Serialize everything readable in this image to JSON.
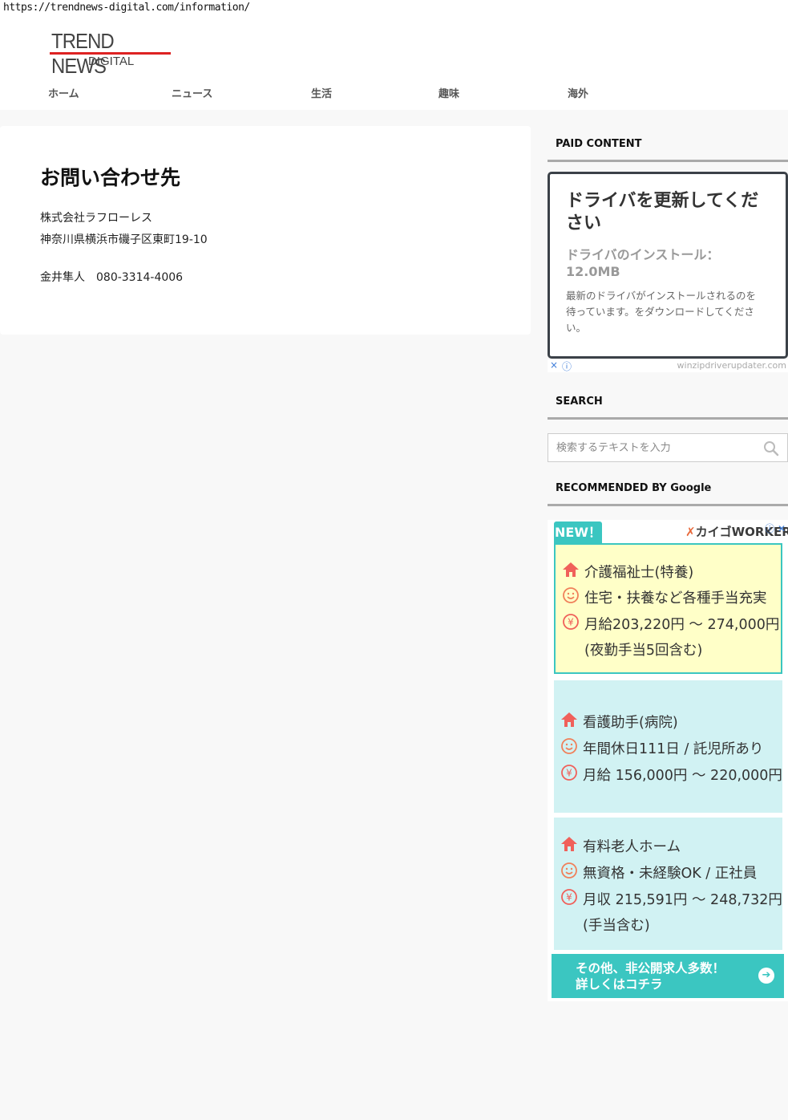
{
  "browser": {
    "url": "https://trendnews-digital.com/information/"
  },
  "site": {
    "logo_main": "TREND NEWS",
    "logo_sub": "DIGITAL",
    "brand_color": "#dd2222"
  },
  "nav": {
    "items": [
      "ホーム",
      "ニュース",
      "生活",
      "趣味",
      "海外"
    ]
  },
  "page": {
    "title": "お問い合わせ先",
    "company": "株式会社ラフローレス",
    "address": "神奈川県横浜市磯子区東町19-10",
    "contact": "金井隼人　080-3314-4006"
  },
  "sidebar": {
    "paid_heading": "PAID CONTENT",
    "search_heading": "SEARCH",
    "recommended_heading": "RECOMMENDED BY Google",
    "search_placeholder": "検索するテキストを入力"
  },
  "ad_driver": {
    "title": "ドライバを更新してください",
    "subtitle": "ドライバのインストール：12.0MB",
    "description": "最新のドライバがインストールされるのを待っています。をダウンロードしてください。",
    "close_icon": "×",
    "info_icon": "ⓘ",
    "domain": "winzipdriverupdater.com"
  },
  "ad_jobs": {
    "badge": "NEW！",
    "brand": "カイゴWORKER",
    "accent_color": "#3bc6c1",
    "cards": [
      {
        "lines": [
          "介護福祉士(特養)",
          "住宅・扶養など各種手当充実",
          "月給203,220円 〜 274,000円",
          "(夜勤手当5回含む)"
        ]
      },
      {
        "lines": [
          "看護助手(病院)",
          "年間休日111日 / 託児所あり",
          "月給 156,000円 〜 220,000円"
        ]
      },
      {
        "lines": [
          "有料老人ホーム",
          "無資格・未経験OK / 正社員",
          "月収 215,591円 〜 248,732円",
          "(手当含む)"
        ]
      }
    ],
    "cta_line1": "その他、非公開求人多数！",
    "cta_line2": "詳しくはコチラ",
    "cta_arrow": "➔"
  }
}
